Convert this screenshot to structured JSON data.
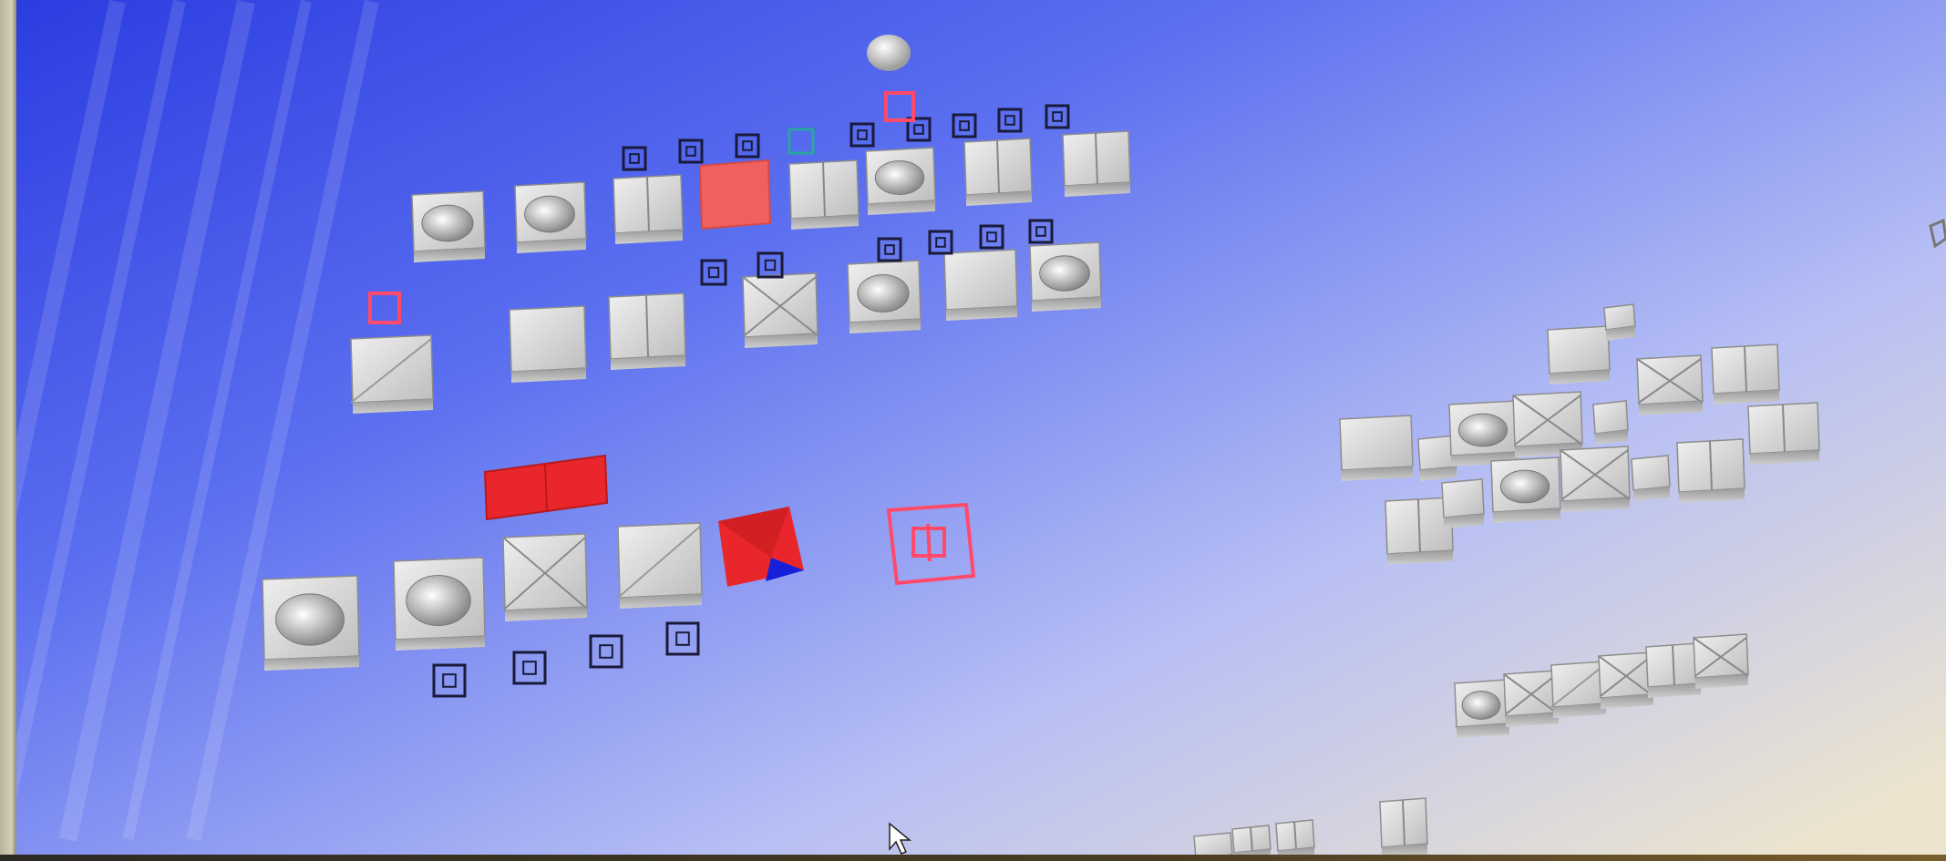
{
  "scene": {
    "description_label": "",
    "background_gradient": [
      "#2d3fe0",
      "#7f8ff0",
      "#c8ccf2",
      "#e2dccc"
    ],
    "highlight_color": "#ff4a6a",
    "selection_fill_color": "#f0615e",
    "part_color": "#d6d6d6",
    "accent_red": "#e8262b",
    "accent_blue": "#1620d8",
    "accent_teal": "#2aa6a0"
  },
  "icons": {
    "pointer": "mouse-pointer-icon",
    "palette_node": "palette-node-icon",
    "tile_part": "tile-part-icon"
  }
}
